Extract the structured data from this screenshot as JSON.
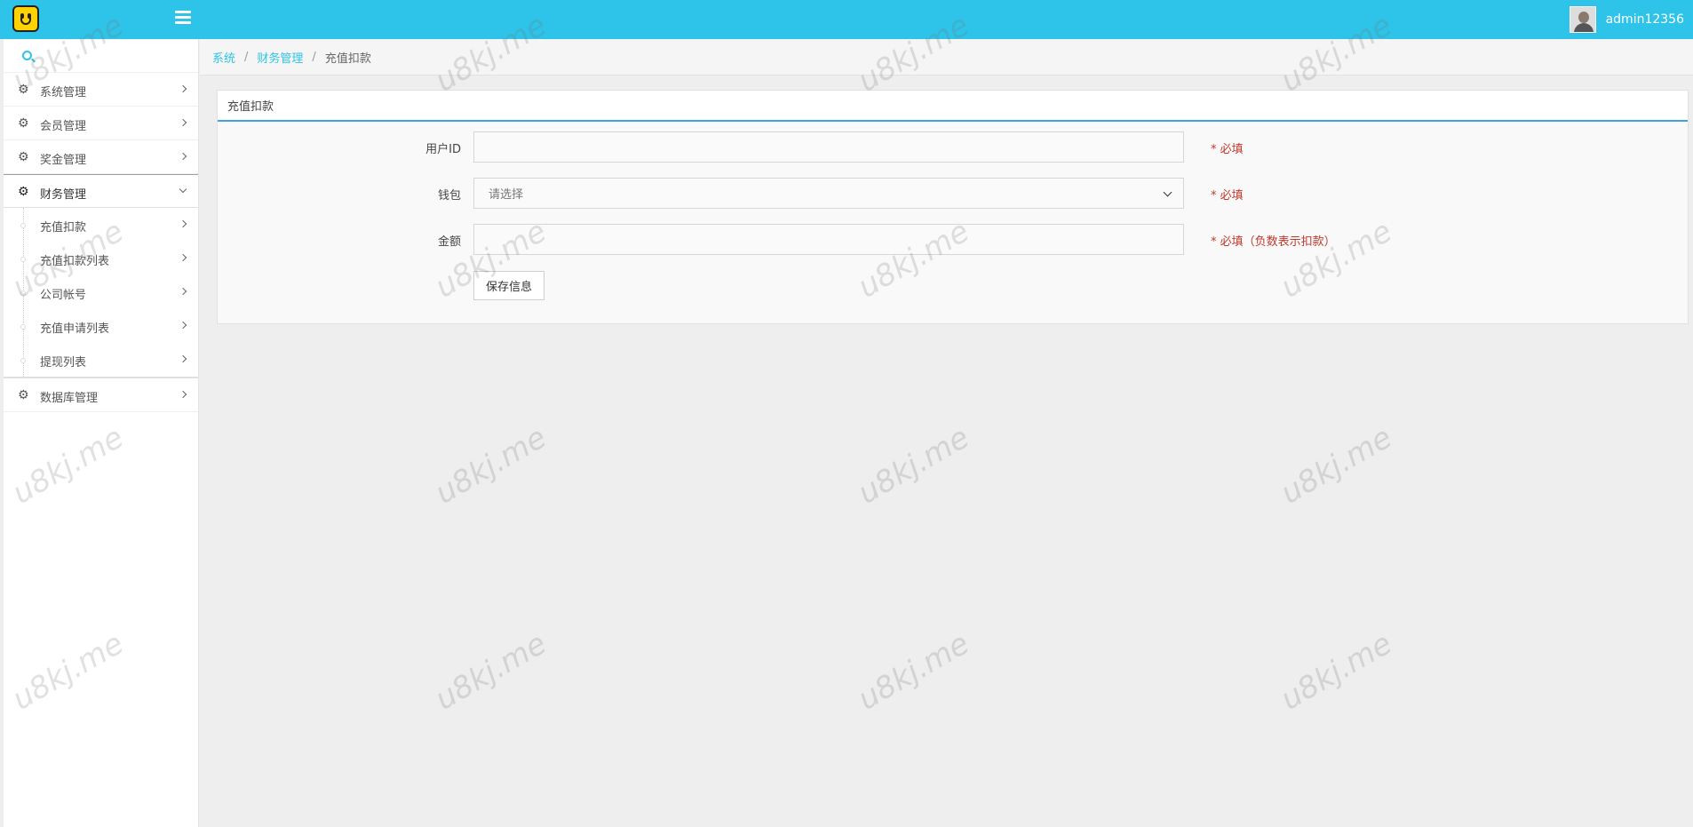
{
  "header": {
    "username": "admin12356"
  },
  "sidebar": {
    "items": [
      {
        "label": "系统管理"
      },
      {
        "label": "会员管理"
      },
      {
        "label": "奖金管理"
      },
      {
        "label": "财务管理",
        "expanded": true
      }
    ],
    "finance_submenu": [
      {
        "label": "充值扣款"
      },
      {
        "label": "充值扣款列表"
      },
      {
        "label": "公司帐号"
      },
      {
        "label": "充值申请列表"
      },
      {
        "label": "提现列表"
      }
    ],
    "after_items": [
      {
        "label": "数据库管理"
      }
    ]
  },
  "breadcrumb": {
    "root": "系统",
    "section": "财务管理",
    "current": "充值扣款"
  },
  "panel": {
    "title": "充值扣款",
    "fields": {
      "user_id_label": "用户ID",
      "user_id_value": "",
      "user_id_note": "* 必填",
      "wallet_label": "钱包",
      "wallet_selected": "请选择",
      "wallet_note": "* 必填",
      "amount_label": "金额",
      "amount_value": "",
      "amount_note": "* 必填（负数表示扣款）"
    },
    "save_label": "保存信息"
  },
  "watermark": "u8kj.me",
  "colors": {
    "topbar": "#2ec3e8",
    "accent": "#2ec3e8",
    "required": "#c0392b",
    "panel_border": "#3fa3e0"
  }
}
